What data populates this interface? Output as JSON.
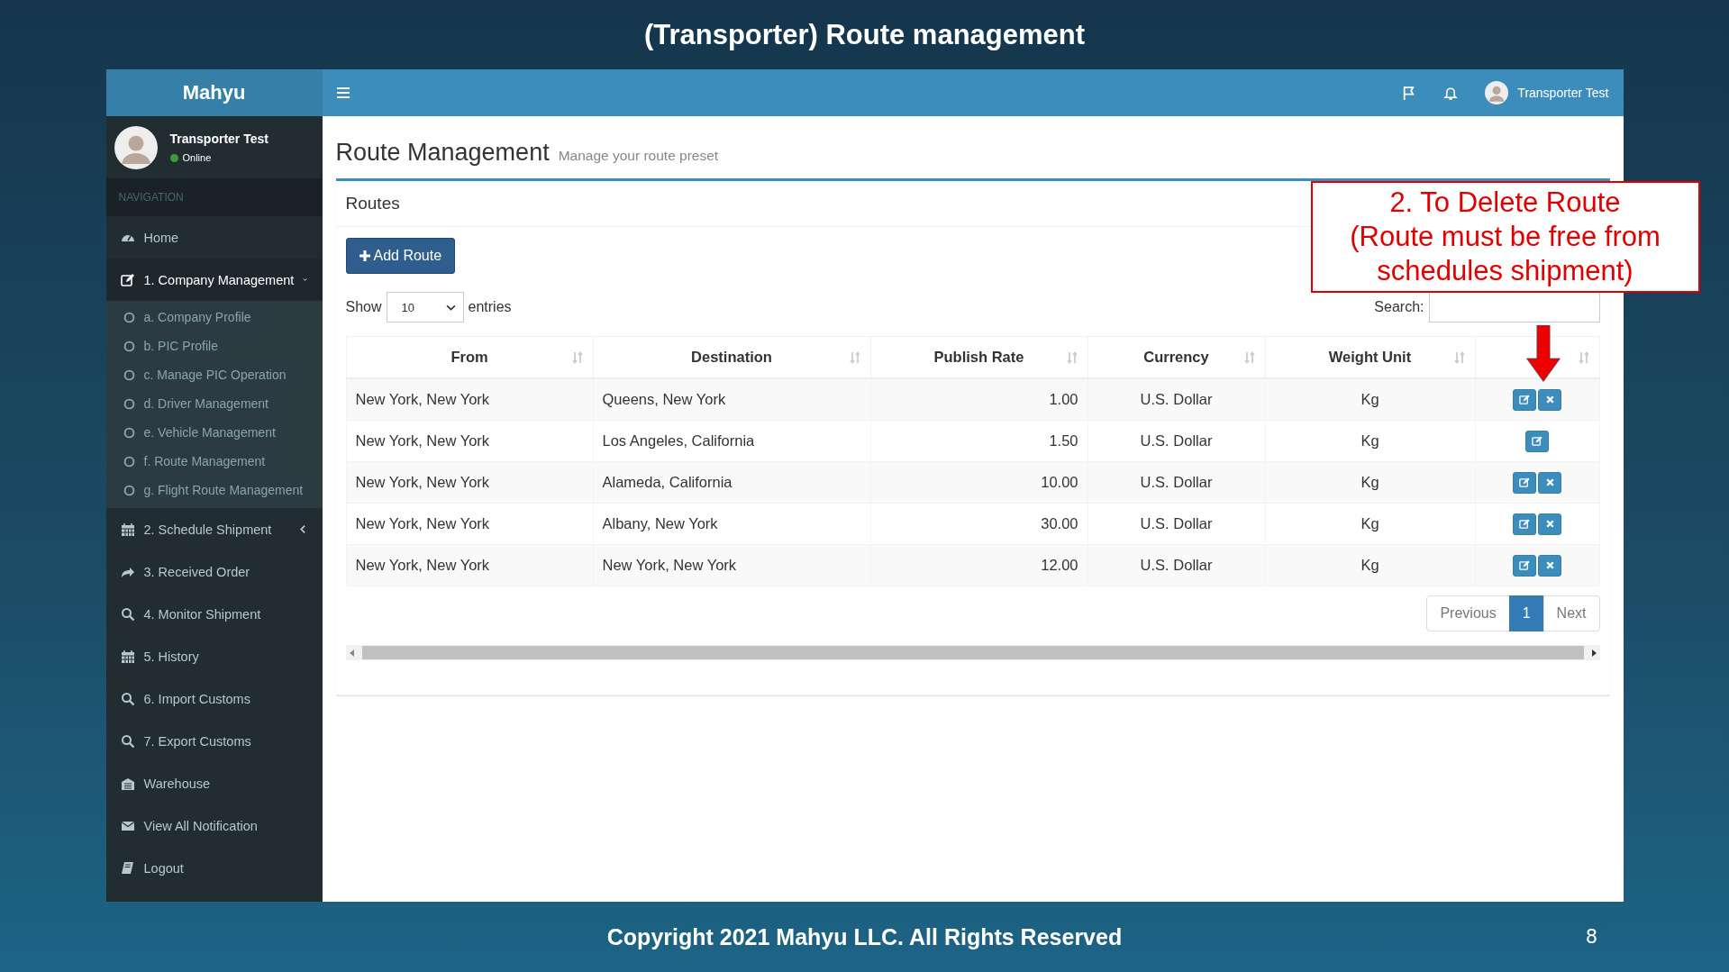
{
  "slide": {
    "title": "(Transporter) Route management",
    "footer": "Copyright 2021 Mahyu LLC. All Rights Reserved",
    "page_number": "8"
  },
  "sidebar": {
    "brand": "Mahyu",
    "user": {
      "name": "Transporter Test",
      "status": "Online"
    },
    "section": "NAVIGATION",
    "items": [
      {
        "label": "Home"
      },
      {
        "label": "1. Company Management",
        "expanded": true,
        "children": [
          {
            "label": "a. Company Profile"
          },
          {
            "label": "b. PIC Profile"
          },
          {
            "label": "c. Manage PIC Operation"
          },
          {
            "label": "d. Driver Management"
          },
          {
            "label": "e. Vehicle Management"
          },
          {
            "label": "f. Route Management"
          },
          {
            "label": "g. Flight Route Management"
          }
        ]
      },
      {
        "label": "2. Schedule Shipment",
        "expanded": false
      },
      {
        "label": "3. Received Order"
      },
      {
        "label": "4. Monitor Shipment"
      },
      {
        "label": "5. History"
      },
      {
        "label": "6. Import Customs"
      },
      {
        "label": "7. Export Customs"
      },
      {
        "label": "Warehouse"
      },
      {
        "label": "View All Notification"
      },
      {
        "label": "Logout"
      }
    ]
  },
  "header": {
    "user_name": "Transporter Test"
  },
  "page": {
    "title": "Route Management",
    "subtitle": "Manage your route preset"
  },
  "box": {
    "title": "Routes",
    "add_button": "Add Route",
    "show_label": "Show",
    "page_length": "10",
    "entries_label": "entries",
    "search_label": "Search:"
  },
  "table": {
    "columns": [
      {
        "label": "From"
      },
      {
        "label": "Destination"
      },
      {
        "label": "Publish Rate"
      },
      {
        "label": "Currency"
      },
      {
        "label": "Weight Unit"
      },
      {}
    ],
    "rows": [
      {
        "cells": [
          "New York, New York",
          "Queens, New York",
          "1.00",
          "U.S. Dollar",
          "Kg"
        ],
        "deletable": true
      },
      {
        "cells": [
          "New York, New York",
          "Los Angeles, California",
          "1.50",
          "U.S. Dollar",
          "Kg"
        ],
        "deletable": false
      },
      {
        "cells": [
          "New York, New York",
          "Alameda, California",
          "10.00",
          "U.S. Dollar",
          "Kg"
        ],
        "deletable": true
      },
      {
        "cells": [
          "New York, New York",
          "Albany, New York",
          "30.00",
          "U.S. Dollar",
          "Kg"
        ],
        "deletable": true
      },
      {
        "cells": [
          "New York, New York",
          "New York, New York",
          "12.00",
          "U.S. Dollar",
          "Kg"
        ],
        "deletable": true
      }
    ]
  },
  "pagination": [
    {
      "label": "Previous",
      "selected": false
    },
    {
      "label": "1",
      "selected": true
    },
    {
      "label": "Next",
      "selected": false
    }
  ],
  "callout": {
    "lines": [
      "2. To Delete Route",
      "(Route must be free from",
      "schedules shipment)"
    ]
  }
}
